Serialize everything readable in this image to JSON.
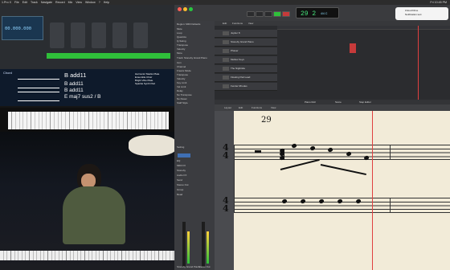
{
  "menubar": {
    "items": [
      "1.Pro X",
      "File",
      "Edit",
      "Track",
      "Navigate",
      "Record",
      "Mix",
      "View",
      "Window",
      "?",
      "Help"
    ],
    "right": "Fri 10:45 PM"
  },
  "left": {
    "mainstage": {
      "time": "00.000.000"
    },
    "chord": {
      "label": "Chord",
      "big": "B add11",
      "lines": [
        "B add11",
        "B add11",
        "E maj7 sus2 / B"
      ],
      "column": [
        "Harmonic Stacks Plate",
        "Ensemble Choir",
        "Bright Vibe Plate",
        "Sparkle Synth Pad"
      ]
    }
  },
  "logic": {
    "lcd": {
      "bar": "29 2",
      "sub": "4/4 C"
    },
    "notification": [
      "iCloud Drive",
      "Notification text"
    ],
    "inspector": [
      "Region: MIDI Defaults",
      "Mute",
      "Loop",
      "Quantize",
      "Q-Swing",
      "Transpose",
      "Velocity",
      "More",
      "Track: Stoneby Grand Piano",
      "Icon",
      "Channel",
      "Freeze Mode",
      "Transpose",
      "Velocity",
      "Key Limit",
      "Vel Limit",
      "Delay",
      "No Transpose",
      "No Reset",
      "Staff Style"
    ],
    "slots": [
      "Setting",
      "EQ",
      "MIDI FX",
      "Stoneby",
      "Audio FX",
      "Send",
      "Stereo Out",
      "Group",
      "Read"
    ],
    "channels": [
      "Stoneby Grand Piano",
      "Stereo Out"
    ],
    "track_header": [
      "Edit",
      "Functions",
      "View"
    ],
    "tracks": [
      "Jupiter 8",
      "Stoneby Grand Piano",
      "Phaser",
      "Mellow Keys",
      "The Nightride",
      "Floating Pad Lead",
      "Fender Rhodes"
    ],
    "editor_tabs": [
      "Piano Roll",
      "Score",
      "Step Editor"
    ],
    "editor_bar": [
      "Layout",
      "Edit",
      "Functions",
      "View"
    ],
    "measure": "29",
    "timesig": [
      "4",
      "4",
      "4",
      "4"
    ]
  }
}
